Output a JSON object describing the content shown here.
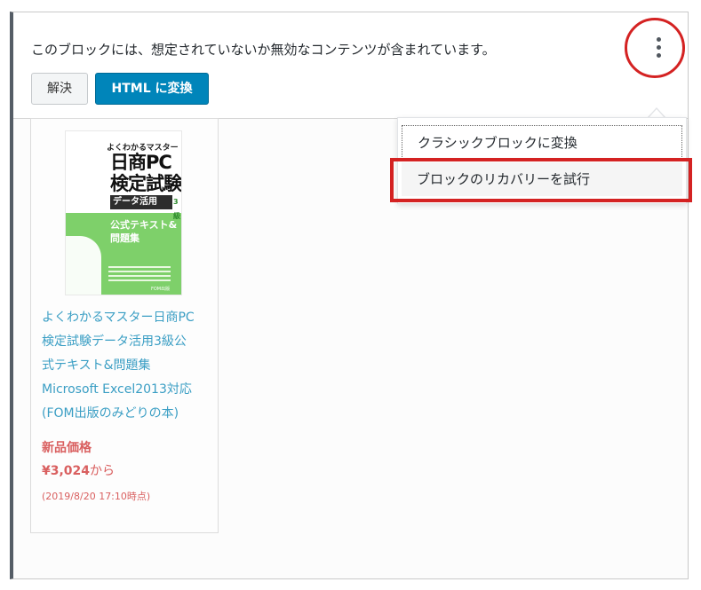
{
  "warning": {
    "message": "このブロックには、想定されていないか無効なコンテンツが含まれています。",
    "resolve_label": "解決",
    "convert_html_label": "HTML に変換"
  },
  "more_menu": {
    "icon": "vertical-ellipsis-icon",
    "items": [
      {
        "label": "クラシックブロックに変換"
      },
      {
        "label": "ブロックのリカバリーを試行"
      }
    ]
  },
  "product": {
    "cover": {
      "series": "よくわかるマスター",
      "title_line1": "日商PC",
      "title_line2": "検定試験",
      "badge": "データ活用",
      "level": "3級",
      "subtitle_line1": "公式テキスト&",
      "subtitle_line2": "問題集",
      "publisher": "FOM出版"
    },
    "title_lines": [
      "よくわかるマスター日商PC",
      "検定試験データ活用3級公",
      "式テキスト&問題集",
      "Microsoft Excel2013対応",
      "(FOM出版のみどりの本)"
    ],
    "price_label": "新品価格",
    "price": "¥3,024",
    "price_suffix": "から",
    "price_date": "(2019/8/20 17:10時点)"
  },
  "colors": {
    "primary_button": "#0085ba",
    "highlight": "#d42222",
    "link": "#3a9ec4",
    "price": "#d95f5f"
  }
}
